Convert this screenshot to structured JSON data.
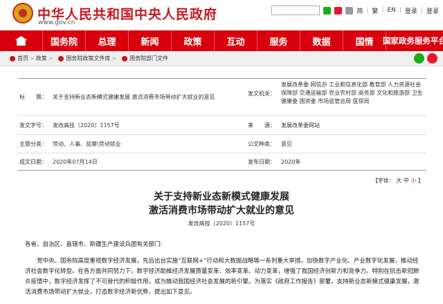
{
  "header": {
    "site_title": "中华人民共和国中央人民政府",
    "site_url": "www.gov.cn",
    "links": [
      "简",
      "繁",
      "EN",
      "登录",
      "登录"
    ],
    "search_placeholder": ""
  },
  "nav": {
    "items": [
      "国务院",
      "总理",
      "新闻",
      "政策",
      "互动",
      "服务",
      "数据",
      "国情",
      "国家政务服务平台"
    ]
  },
  "breadcrumb": {
    "items": [
      "首页",
      "政策",
      "国务院政策文件库",
      "国务院部门文件"
    ]
  },
  "meta": {
    "title_label": "标　　题：",
    "title_value": "关于支持新业态新模式健康发展 激活消费市场带动扩大就业的意见",
    "issuer_label": "发文机关：",
    "issuer_value": "发展改革委 网信办 工业和信息化部 教育部 人力资源社会保障部 交通运输部 农业农村部 商务部 文化和旅游部 卫生健康委 国资委 市场监管总局 医保局",
    "docnum_label": "发文字号：",
    "docnum_value": "发改高技〔2020〕1157号",
    "source_label": "来　　源：",
    "source_value": "发展改革委网站",
    "topic_label": "主题分类：",
    "topic_value": "劳动、人事、监察\\劳动就业",
    "genre_label": "公文种类：",
    "genre_value": "意见",
    "written_label": "成文日期：",
    "written_value": "2020年07月14日",
    "published_label": "发布日期：",
    "published_value": "2020年"
  },
  "font_ctrl": {
    "label": "【字体：",
    "large": "大",
    "medium": "中",
    "small": "小",
    "end": "】"
  },
  "article": {
    "title_line1": "关于支持新业态新模式健康发展",
    "title_line2": "激活消费市场带动扩大就业的意见",
    "doc_number": "发改高技〔2020〕1157号",
    "salutation": "各省、自治区、直辖市、新疆生产建设兵团有关部门:",
    "body": "党中央、国务院高度重视数字经济发展，先后出台实施“互联网+”行动和大数据战略等一系列重大举措，加快数字产业化、产业数字化发展，推动经济社会数字化转型。在各方面共同努力下，数字经济助推经济发展质量变革、效率变革、动力变革，增强了我国经济创新力和竞争力。特别在抗击新冠肺炎疫情中，数字经济发挥了不可替代的积极作用，成为推动我国经济社会发展的新引擎。为落实《政府工作报告》部署，支持新业态新模式健康发展，激活消费市场带动扩大就业，打造数字经济新优势，提出如下意见。"
  },
  "colors": {
    "brand_red": "#d8000c",
    "title_red": "#c8161e"
  }
}
